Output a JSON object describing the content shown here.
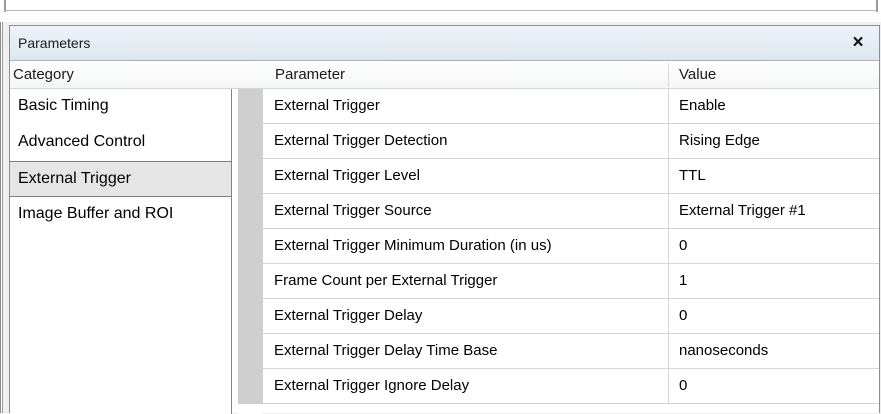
{
  "panel": {
    "title": "Parameters",
    "close_label": "×"
  },
  "columns": {
    "category": "Category",
    "parameter": "Parameter",
    "value": "Value"
  },
  "categories": [
    {
      "label": "Basic Timing",
      "selected": false
    },
    {
      "label": "Advanced Control",
      "selected": false
    },
    {
      "label": "External Trigger",
      "selected": true
    },
    {
      "label": "Image Buffer and ROI",
      "selected": false
    }
  ],
  "parameters": [
    {
      "name": "External Trigger",
      "value": "Enable"
    },
    {
      "name": "External Trigger Detection",
      "value": "Rising Edge"
    },
    {
      "name": "External Trigger Level",
      "value": "TTL"
    },
    {
      "name": "External Trigger Source",
      "value": "External Trigger #1"
    },
    {
      "name": "External Trigger Minimum Duration (in us)",
      "value": "0"
    },
    {
      "name": "Frame Count per External Trigger",
      "value": "1"
    },
    {
      "name": "External Trigger Delay",
      "value": "0"
    },
    {
      "name": "External Trigger Delay Time Base",
      "value": "nanoseconds"
    },
    {
      "name": "External Trigger Ignore Delay",
      "value": "0"
    }
  ]
}
